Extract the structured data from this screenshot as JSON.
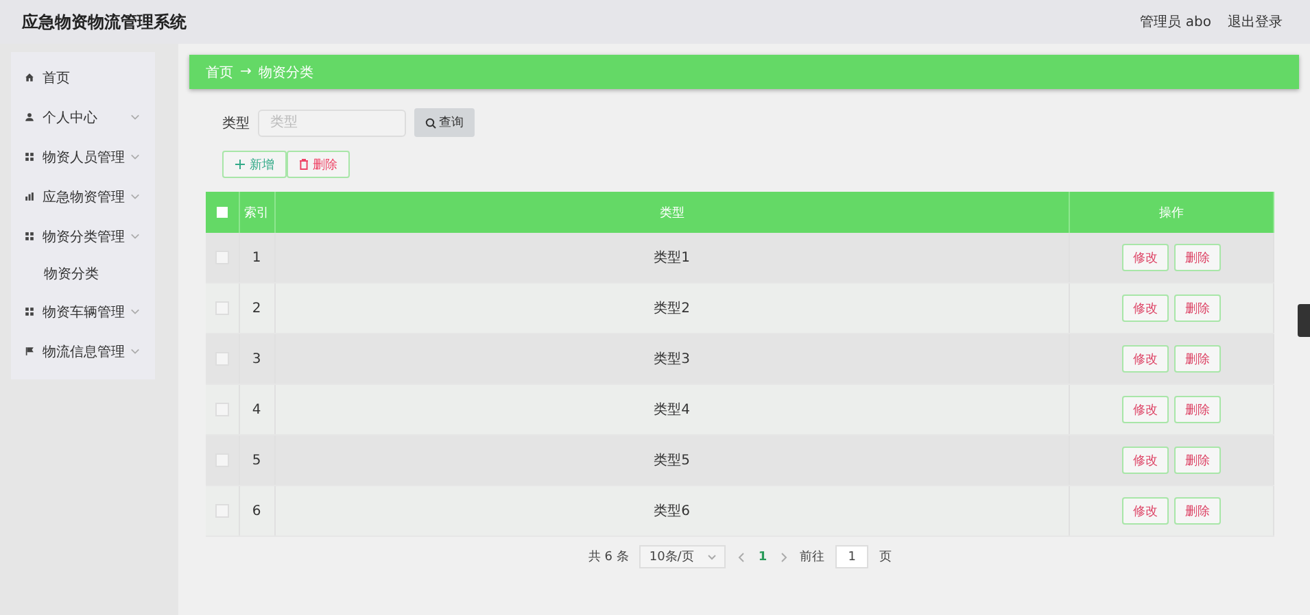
{
  "header": {
    "title": "应急物资物流管理系统",
    "user": "管理员 abo",
    "logout": "退出登录"
  },
  "sidebar": {
    "items": [
      {
        "label": "首页",
        "has_arrow": false
      },
      {
        "label": "个人中心",
        "has_arrow": true
      },
      {
        "label": "物资人员管理",
        "has_arrow": true
      },
      {
        "label": "应急物资管理",
        "has_arrow": true
      },
      {
        "label": "物资分类管理",
        "has_arrow": true,
        "children": [
          {
            "label": "物资分类"
          }
        ]
      },
      {
        "label": "物资车辆管理",
        "has_arrow": true
      },
      {
        "label": "物流信息管理",
        "has_arrow": true
      }
    ]
  },
  "breadcrumb": {
    "items": [
      "首页",
      "物资分类"
    ],
    "separator": "→"
  },
  "search": {
    "label": "类型",
    "placeholder": "类型",
    "button": "查询"
  },
  "actions": {
    "add": "新增",
    "delete": "删除"
  },
  "table": {
    "select_all_checked": false,
    "columns": [
      "索引",
      "类型",
      "操作"
    ],
    "rows": [
      {
        "checked": false,
        "index": "1",
        "type": "类型1",
        "edit": "修改",
        "delete": "删除"
      },
      {
        "checked": false,
        "index": "2",
        "type": "类型2",
        "edit": "修改",
        "delete": "删除"
      },
      {
        "checked": false,
        "index": "3",
        "type": "类型3",
        "edit": "修改",
        "delete": "删除"
      },
      {
        "checked": false,
        "index": "4",
        "type": "类型4",
        "edit": "修改",
        "delete": "删除"
      },
      {
        "checked": false,
        "index": "5",
        "type": "类型5",
        "edit": "修改",
        "delete": "删除"
      },
      {
        "checked": false,
        "index": "6",
        "type": "类型6",
        "edit": "修改",
        "delete": "删除"
      }
    ]
  },
  "pagination": {
    "total": "共 6 条",
    "page_size": "10条/页",
    "pages": [
      {
        "label": "1",
        "selected": true
      }
    ],
    "goto_label": "前往",
    "goto_value": "1",
    "page_unit": "页"
  }
}
